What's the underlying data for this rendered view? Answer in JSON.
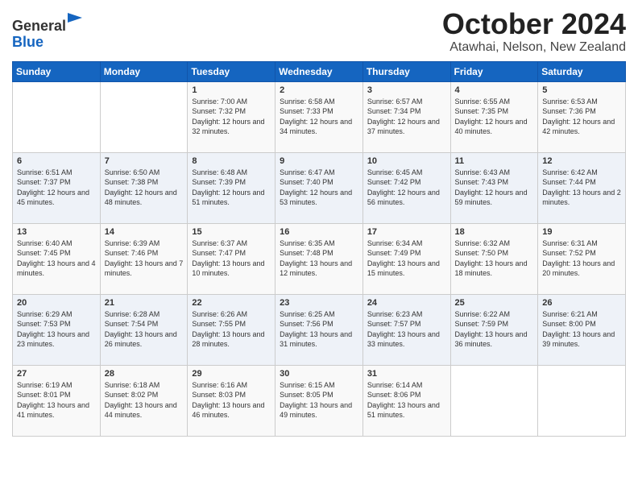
{
  "header": {
    "logo": {
      "line1": "General",
      "line2": "Blue"
    },
    "title": "October 2024",
    "location": "Atawhai, Nelson, New Zealand"
  },
  "days_of_week": [
    "Sunday",
    "Monday",
    "Tuesday",
    "Wednesday",
    "Thursday",
    "Friday",
    "Saturday"
  ],
  "weeks": [
    [
      {
        "day": "",
        "sunrise": "",
        "sunset": "",
        "daylight": "",
        "empty": true
      },
      {
        "day": "",
        "sunrise": "",
        "sunset": "",
        "daylight": "",
        "empty": true
      },
      {
        "day": "1",
        "sunrise": "Sunrise: 7:00 AM",
        "sunset": "Sunset: 7:32 PM",
        "daylight": "Daylight: 12 hours and 32 minutes."
      },
      {
        "day": "2",
        "sunrise": "Sunrise: 6:58 AM",
        "sunset": "Sunset: 7:33 PM",
        "daylight": "Daylight: 12 hours and 34 minutes."
      },
      {
        "day": "3",
        "sunrise": "Sunrise: 6:57 AM",
        "sunset": "Sunset: 7:34 PM",
        "daylight": "Daylight: 12 hours and 37 minutes."
      },
      {
        "day": "4",
        "sunrise": "Sunrise: 6:55 AM",
        "sunset": "Sunset: 7:35 PM",
        "daylight": "Daylight: 12 hours and 40 minutes."
      },
      {
        "day": "5",
        "sunrise": "Sunrise: 6:53 AM",
        "sunset": "Sunset: 7:36 PM",
        "daylight": "Daylight: 12 hours and 42 minutes."
      }
    ],
    [
      {
        "day": "6",
        "sunrise": "Sunrise: 6:51 AM",
        "sunset": "Sunset: 7:37 PM",
        "daylight": "Daylight: 12 hours and 45 minutes."
      },
      {
        "day": "7",
        "sunrise": "Sunrise: 6:50 AM",
        "sunset": "Sunset: 7:38 PM",
        "daylight": "Daylight: 12 hours and 48 minutes."
      },
      {
        "day": "8",
        "sunrise": "Sunrise: 6:48 AM",
        "sunset": "Sunset: 7:39 PM",
        "daylight": "Daylight: 12 hours and 51 minutes."
      },
      {
        "day": "9",
        "sunrise": "Sunrise: 6:47 AM",
        "sunset": "Sunset: 7:40 PM",
        "daylight": "Daylight: 12 hours and 53 minutes."
      },
      {
        "day": "10",
        "sunrise": "Sunrise: 6:45 AM",
        "sunset": "Sunset: 7:42 PM",
        "daylight": "Daylight: 12 hours and 56 minutes."
      },
      {
        "day": "11",
        "sunrise": "Sunrise: 6:43 AM",
        "sunset": "Sunset: 7:43 PM",
        "daylight": "Daylight: 12 hours and 59 minutes."
      },
      {
        "day": "12",
        "sunrise": "Sunrise: 6:42 AM",
        "sunset": "Sunset: 7:44 PM",
        "daylight": "Daylight: 13 hours and 2 minutes."
      }
    ],
    [
      {
        "day": "13",
        "sunrise": "Sunrise: 6:40 AM",
        "sunset": "Sunset: 7:45 PM",
        "daylight": "Daylight: 13 hours and 4 minutes."
      },
      {
        "day": "14",
        "sunrise": "Sunrise: 6:39 AM",
        "sunset": "Sunset: 7:46 PM",
        "daylight": "Daylight: 13 hours and 7 minutes."
      },
      {
        "day": "15",
        "sunrise": "Sunrise: 6:37 AM",
        "sunset": "Sunset: 7:47 PM",
        "daylight": "Daylight: 13 hours and 10 minutes."
      },
      {
        "day": "16",
        "sunrise": "Sunrise: 6:35 AM",
        "sunset": "Sunset: 7:48 PM",
        "daylight": "Daylight: 13 hours and 12 minutes."
      },
      {
        "day": "17",
        "sunrise": "Sunrise: 6:34 AM",
        "sunset": "Sunset: 7:49 PM",
        "daylight": "Daylight: 13 hours and 15 minutes."
      },
      {
        "day": "18",
        "sunrise": "Sunrise: 6:32 AM",
        "sunset": "Sunset: 7:50 PM",
        "daylight": "Daylight: 13 hours and 18 minutes."
      },
      {
        "day": "19",
        "sunrise": "Sunrise: 6:31 AM",
        "sunset": "Sunset: 7:52 PM",
        "daylight": "Daylight: 13 hours and 20 minutes."
      }
    ],
    [
      {
        "day": "20",
        "sunrise": "Sunrise: 6:29 AM",
        "sunset": "Sunset: 7:53 PM",
        "daylight": "Daylight: 13 hours and 23 minutes."
      },
      {
        "day": "21",
        "sunrise": "Sunrise: 6:28 AM",
        "sunset": "Sunset: 7:54 PM",
        "daylight": "Daylight: 13 hours and 26 minutes."
      },
      {
        "day": "22",
        "sunrise": "Sunrise: 6:26 AM",
        "sunset": "Sunset: 7:55 PM",
        "daylight": "Daylight: 13 hours and 28 minutes."
      },
      {
        "day": "23",
        "sunrise": "Sunrise: 6:25 AM",
        "sunset": "Sunset: 7:56 PM",
        "daylight": "Daylight: 13 hours and 31 minutes."
      },
      {
        "day": "24",
        "sunrise": "Sunrise: 6:23 AM",
        "sunset": "Sunset: 7:57 PM",
        "daylight": "Daylight: 13 hours and 33 minutes."
      },
      {
        "day": "25",
        "sunrise": "Sunrise: 6:22 AM",
        "sunset": "Sunset: 7:59 PM",
        "daylight": "Daylight: 13 hours and 36 minutes."
      },
      {
        "day": "26",
        "sunrise": "Sunrise: 6:21 AM",
        "sunset": "Sunset: 8:00 PM",
        "daylight": "Daylight: 13 hours and 39 minutes."
      }
    ],
    [
      {
        "day": "27",
        "sunrise": "Sunrise: 6:19 AM",
        "sunset": "Sunset: 8:01 PM",
        "daylight": "Daylight: 13 hours and 41 minutes."
      },
      {
        "day": "28",
        "sunrise": "Sunrise: 6:18 AM",
        "sunset": "Sunset: 8:02 PM",
        "daylight": "Daylight: 13 hours and 44 minutes."
      },
      {
        "day": "29",
        "sunrise": "Sunrise: 6:16 AM",
        "sunset": "Sunset: 8:03 PM",
        "daylight": "Daylight: 13 hours and 46 minutes."
      },
      {
        "day": "30",
        "sunrise": "Sunrise: 6:15 AM",
        "sunset": "Sunset: 8:05 PM",
        "daylight": "Daylight: 13 hours and 49 minutes."
      },
      {
        "day": "31",
        "sunrise": "Sunrise: 6:14 AM",
        "sunset": "Sunset: 8:06 PM",
        "daylight": "Daylight: 13 hours and 51 minutes."
      },
      {
        "day": "",
        "sunrise": "",
        "sunset": "",
        "daylight": "",
        "empty": true
      },
      {
        "day": "",
        "sunrise": "",
        "sunset": "",
        "daylight": "",
        "empty": true
      }
    ]
  ]
}
